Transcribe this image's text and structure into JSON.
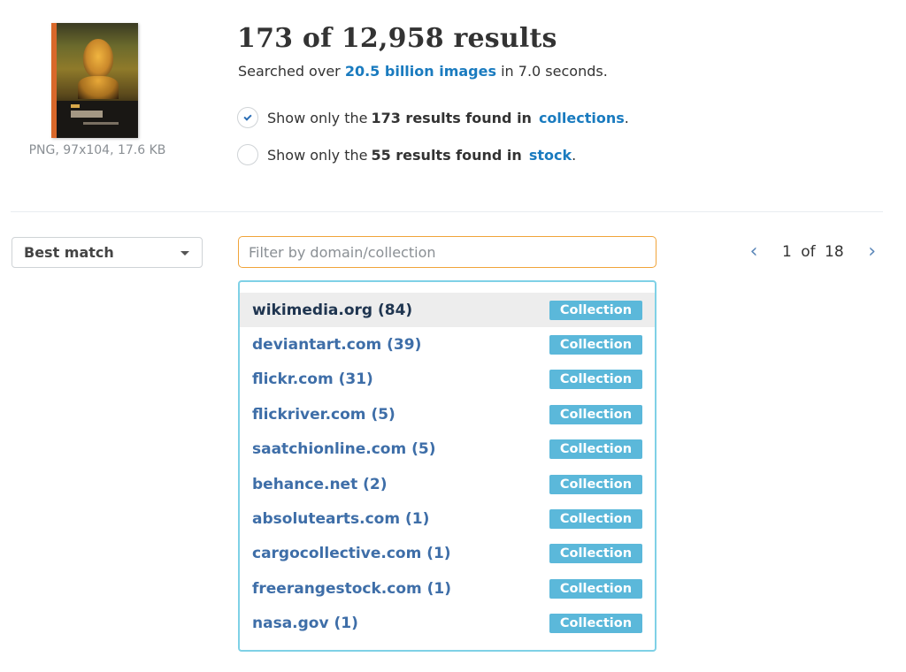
{
  "image": {
    "icon": "mona-lisa-book-cover-thumbnail",
    "meta": "PNG, 97x104, 17.6 KB"
  },
  "header": {
    "title": "173 of 12,958 results",
    "subtitle_prefix": "Searched over",
    "subtitle_link": "20.5 billion images",
    "subtitle_suffix": "in 7.0 seconds."
  },
  "options": [
    {
      "checked": true,
      "prefix": "Show only the",
      "bold": "173 results found in",
      "link": "collections",
      "suffix": "."
    },
    {
      "checked": false,
      "prefix": "Show only the",
      "bold": "55 results found in",
      "link": "stock",
      "suffix": "."
    }
  ],
  "sort": {
    "selected": "Best match"
  },
  "filter": {
    "placeholder": "Filter by domain/collection",
    "value": ""
  },
  "pagination": {
    "text": "1 of 18",
    "prev_icon": "chevron-left",
    "next_icon": "chevron-right"
  },
  "domains": [
    {
      "label": "wikimedia.org (84)",
      "badge": "Collection"
    },
    {
      "label": "deviantart.com (39)",
      "badge": "Collection"
    },
    {
      "label": "flickr.com (31)",
      "badge": "Collection"
    },
    {
      "label": "flickriver.com (5)",
      "badge": "Collection"
    },
    {
      "label": "saatchionline.com (5)",
      "badge": "Collection"
    },
    {
      "label": "behance.net (2)",
      "badge": "Collection"
    },
    {
      "label": "absolutearts.com (1)",
      "badge": "Collection"
    },
    {
      "label": "cargocollective.com (1)",
      "badge": "Collection"
    },
    {
      "label": "freerangestock.com (1)",
      "badge": "Collection"
    },
    {
      "label": "nasa.gov (1)",
      "badge": "Collection"
    }
  ],
  "colors": {
    "link": "#1a7bbf",
    "badge": "#5bb8da",
    "filter_border": "#f0a43a",
    "list_border": "#7fd1e6",
    "domain_text": "#3e6ea8"
  }
}
